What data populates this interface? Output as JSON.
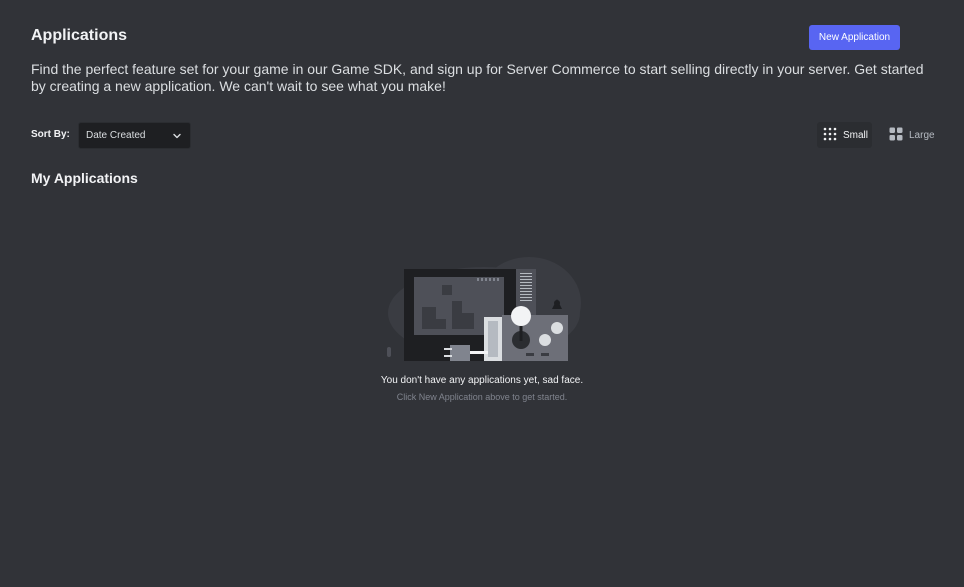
{
  "header": {
    "title": "Applications",
    "new_app_label": "New Application",
    "description": "Find the perfect feature set for your game in our Game SDK, and sign up for Server Commerce to start selling directly in your server. Get started by creating a new application. We can't wait to see what you make!"
  },
  "sort": {
    "label": "Sort By:",
    "selected": "Date Created"
  },
  "view_toggle": {
    "small_label": "Small",
    "large_label": "Large",
    "active": "Small"
  },
  "section": {
    "title": "My Applications"
  },
  "empty_state": {
    "title": "You don't have any applications yet, sad face.",
    "subtitle": "Click New Application above to get started."
  },
  "colors": {
    "background": "#313338",
    "accent": "#5865f2"
  },
  "icons": {
    "sort_chevron": "chevron-down-icon",
    "small_view": "grid-small-icon",
    "large_view": "grid-large-icon"
  }
}
